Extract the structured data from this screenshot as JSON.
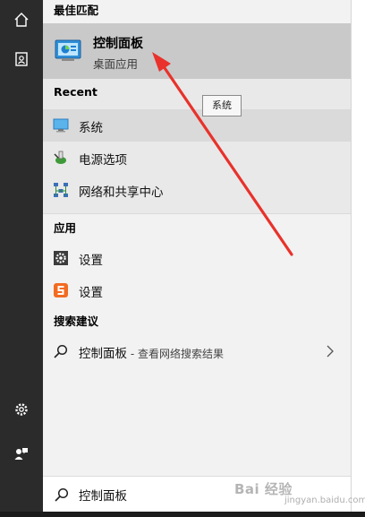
{
  "rail": {
    "icons": [
      "home-icon",
      "contact-card-icon",
      "gear-icon",
      "user-feedback-icon"
    ]
  },
  "best_match": {
    "heading": "最佳匹配",
    "title": "控制面板",
    "subtitle": "桌面应用"
  },
  "recent": {
    "heading": "Recent",
    "items": [
      {
        "label": "系统",
        "icon": "monitor-icon"
      },
      {
        "label": "电源选项",
        "icon": "power-options-icon"
      },
      {
        "label": "网络和共享中心",
        "icon": "network-icon"
      }
    ]
  },
  "apps": {
    "heading": "应用",
    "items": [
      {
        "label": "设置",
        "icon": "gear-icon"
      },
      {
        "label": "设置",
        "icon": "sogou-s-icon"
      }
    ]
  },
  "suggestions": {
    "heading": "搜索建议",
    "item_title": "控制面板",
    "item_sub": " - 查看网络搜索结果"
  },
  "tooltip": "系统",
  "search": {
    "value": "控制面板"
  },
  "watermark": {
    "text": "Bai 经验",
    "sub": "jingyan.baidu.com"
  },
  "colors": {
    "rail": "#2b2b2b",
    "panel": "#f2f2f2",
    "best_match_bg": "#c9c9c9",
    "highlight": "#dadada",
    "annotation_arrow": "#e8322b"
  }
}
